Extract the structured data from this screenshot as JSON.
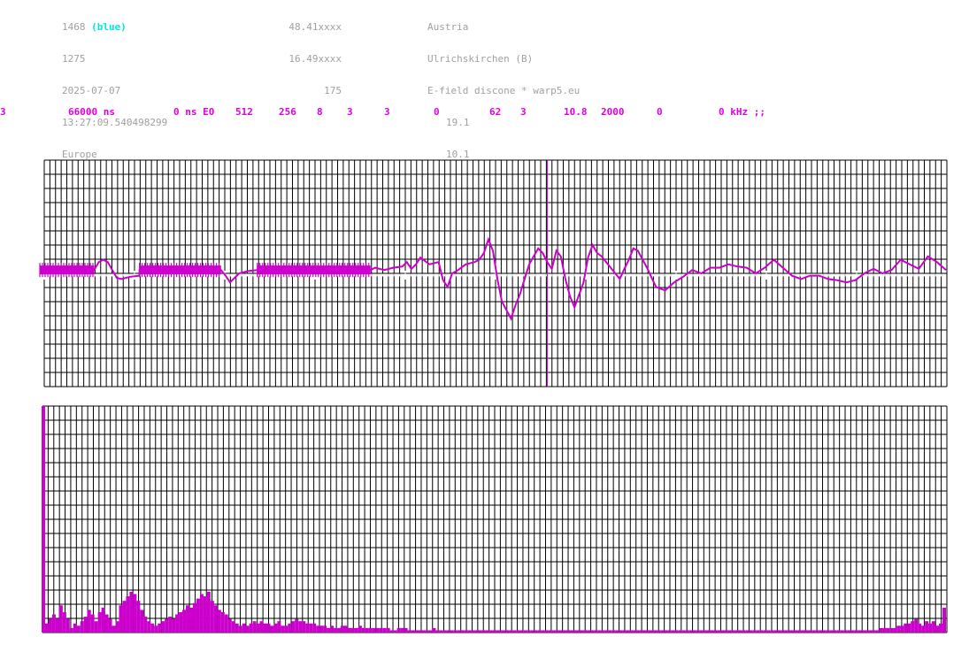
{
  "header": {
    "col1": [
      "1468",
      "1275",
      "2025-07-07",
      "13:27:09.540498299",
      "Europe"
    ],
    "col1_suffix": "(blue)",
    "col2": [
      "48.41xxxx",
      "16.49xxxx",
      "175"
    ],
    "col3": [
      "Austria",
      "Ulrichskirchen (B)",
      "E-field discone * warp5.eu",
      "19.1",
      "10.1"
    ]
  },
  "params": [
    "3",
    "66000 ns",
    "0 ns E0",
    "512",
    "256",
    "8",
    "3",
    "3",
    "0",
    "62",
    "3",
    "10.8",
    "2000",
    "0",
    "0 kHz ;;"
  ],
  "colors": {
    "signal": "#cc00cc",
    "param": "#e000e0",
    "grid": "#000000",
    "highlight": "#00e5e5"
  },
  "chart_data": [
    {
      "type": "line",
      "title": "",
      "xlabel": "",
      "ylabel": "",
      "grid": true,
      "xlim": [
        0,
        1
      ],
      "ylim": [
        -1,
        1
      ],
      "cursor_x": 0.56,
      "x": [
        0,
        0.06,
        0.065,
        0.07,
        0.075,
        0.08,
        0.085,
        0.09,
        0.1,
        0.11,
        0.11,
        0.2,
        0.205,
        0.21,
        0.22,
        0.23,
        0.24,
        0.24,
        0.365,
        0.37,
        0.38,
        0.39,
        0.4,
        0.405,
        0.41,
        0.415,
        0.42,
        0.43,
        0.44,
        0.445,
        0.45,
        0.455,
        0.46,
        0.47,
        0.48,
        0.485,
        0.49,
        0.495,
        0.5,
        0.505,
        0.51,
        0.52,
        0.525,
        0.53,
        0.535,
        0.54,
        0.545,
        0.55,
        0.555,
        0.56,
        0.565,
        0.57,
        0.575,
        0.58,
        0.585,
        0.59,
        0.6,
        0.605,
        0.61,
        0.615,
        0.62,
        0.625,
        0.63,
        0.64,
        0.645,
        0.65,
        0.655,
        0.66,
        0.67,
        0.68,
        0.69,
        0.7,
        0.71,
        0.72,
        0.73,
        0.74,
        0.75,
        0.76,
        0.77,
        0.78,
        0.79,
        0.8,
        0.81,
        0.82,
        0.83,
        0.84,
        0.85,
        0.86,
        0.87,
        0.88,
        0.89,
        0.9,
        0.91,
        0.92,
        0.93,
        0.94,
        0.95,
        0.96,
        0.97,
        0.98,
        0.99,
        1.0
      ],
      "y": [
        0.03,
        0.03,
        0.1,
        0.12,
        0.1,
        0.03,
        -0.04,
        -0.05,
        -0.03,
        -0.02,
        0.03,
        0.03,
        -0.02,
        -0.08,
        0.0,
        0.02,
        0.03,
        0.03,
        0.03,
        0.05,
        0.03,
        0.05,
        0.06,
        0.1,
        0.04,
        0.08,
        0.14,
        0.08,
        0.1,
        -0.06,
        -0.12,
        0.0,
        0.02,
        0.08,
        0.1,
        0.12,
        0.18,
        0.3,
        0.2,
        -0.05,
        -0.25,
        -0.4,
        -0.28,
        -0.18,
        -0.05,
        0.08,
        0.15,
        0.22,
        0.18,
        0.1,
        0.04,
        0.2,
        0.15,
        -0.05,
        -0.2,
        -0.3,
        -0.08,
        0.14,
        0.25,
        0.18,
        0.15,
        0.1,
        0.05,
        -0.05,
        0.04,
        0.12,
        0.22,
        0.2,
        0.05,
        -0.12,
        -0.15,
        -0.08,
        -0.03,
        0.03,
        0.0,
        0.05,
        0.05,
        0.08,
        0.06,
        0.05,
        0.0,
        0.05,
        0.12,
        0.05,
        -0.02,
        -0.05,
        -0.02,
        -0.02,
        -0.05,
        -0.06,
        -0.08,
        -0.06,
        0.0,
        0.04,
        0.0,
        0.03,
        0.12,
        0.08,
        0.04,
        0.15,
        0.1,
        0.03
      ]
    },
    {
      "type": "bar",
      "title": "",
      "xlabel": "",
      "ylabel": "",
      "grid": true,
      "ylim": [
        0,
        1
      ],
      "values": [
        1.0,
        0.04,
        0.06,
        0.08,
        0.06,
        0.12,
        0.09,
        0.06,
        0.02,
        0.04,
        0.03,
        0.05,
        0.07,
        0.1,
        0.08,
        0.05,
        0.09,
        0.11,
        0.08,
        0.06,
        0.03,
        0.05,
        0.12,
        0.14,
        0.16,
        0.18,
        0.17,
        0.14,
        0.1,
        0.07,
        0.05,
        0.04,
        0.03,
        0.04,
        0.05,
        0.06,
        0.07,
        0.06,
        0.08,
        0.09,
        0.1,
        0.12,
        0.11,
        0.13,
        0.15,
        0.17,
        0.16,
        0.18,
        0.14,
        0.12,
        0.1,
        0.09,
        0.08,
        0.06,
        0.05,
        0.04,
        0.03,
        0.04,
        0.03,
        0.04,
        0.05,
        0.04,
        0.05,
        0.04,
        0.04,
        0.03,
        0.04,
        0.05,
        0.03,
        0.03,
        0.04,
        0.05,
        0.06,
        0.05,
        0.05,
        0.04,
        0.04,
        0.04,
        0.03,
        0.03,
        0.03,
        0.02,
        0.03,
        0.02,
        0.02,
        0.03,
        0.03,
        0.02,
        0.02,
        0.02,
        0.03,
        0.02,
        0.02,
        0.02,
        0.02,
        0.02,
        0.02,
        0.02,
        0.02,
        0.01,
        0.01,
        0.02,
        0.02,
        0.02,
        0.01,
        0.01,
        0.01,
        0.01,
        0.01,
        0.01,
        0.01,
        0.02,
        0.01,
        0.01,
        0.01,
        0.01,
        0.01,
        0.01,
        0.01,
        0.01,
        0.01,
        0.01,
        0.01,
        0.01,
        0.01,
        0.01,
        0.01,
        0.01,
        0.01,
        0.01,
        0.01,
        0.01,
        0.01,
        0.01,
        0.01,
        0.01,
        0.01,
        0.01,
        0.01,
        0.01,
        0.01,
        0.01,
        0.01,
        0.01,
        0.01,
        0.01,
        0.01,
        0.01,
        0.01,
        0.01,
        0.01,
        0.01,
        0.01,
        0.01,
        0.01,
        0.01,
        0.01,
        0.01,
        0.01,
        0.01,
        0.01,
        0.01,
        0.01,
        0.01,
        0.01,
        0.01,
        0.01,
        0.01,
        0.01,
        0.01,
        0.01,
        0.01,
        0.01,
        0.01,
        0.01,
        0.01,
        0.01,
        0.01,
        0.01,
        0.01,
        0.01,
        0.01,
        0.01,
        0.01,
        0.01,
        0.01,
        0.01,
        0.01,
        0.01,
        0.01,
        0.01,
        0.01,
        0.01,
        0.01,
        0.01,
        0.01,
        0.01,
        0.01,
        0.01,
        0.01,
        0.01,
        0.01,
        0.01,
        0.01,
        0.01,
        0.01,
        0.01,
        0.01,
        0.01,
        0.01,
        0.01,
        0.01,
        0.01,
        0.01,
        0.01,
        0.01,
        0.01,
        0.01,
        0.01,
        0.01,
        0.01,
        0.01,
        0.01,
        0.01,
        0.01,
        0.01,
        0.01,
        0.01,
        0.01,
        0.01,
        0.01,
        0.01,
        0.01,
        0.01,
        0.01,
        0.01,
        0.01,
        0.01,
        0.02,
        0.02,
        0.02,
        0.02,
        0.02,
        0.03,
        0.03,
        0.04,
        0.04,
        0.05,
        0.06,
        0.04,
        0.03,
        0.05,
        0.04,
        0.05,
        0.03,
        0.04,
        0.11
      ]
    }
  ]
}
